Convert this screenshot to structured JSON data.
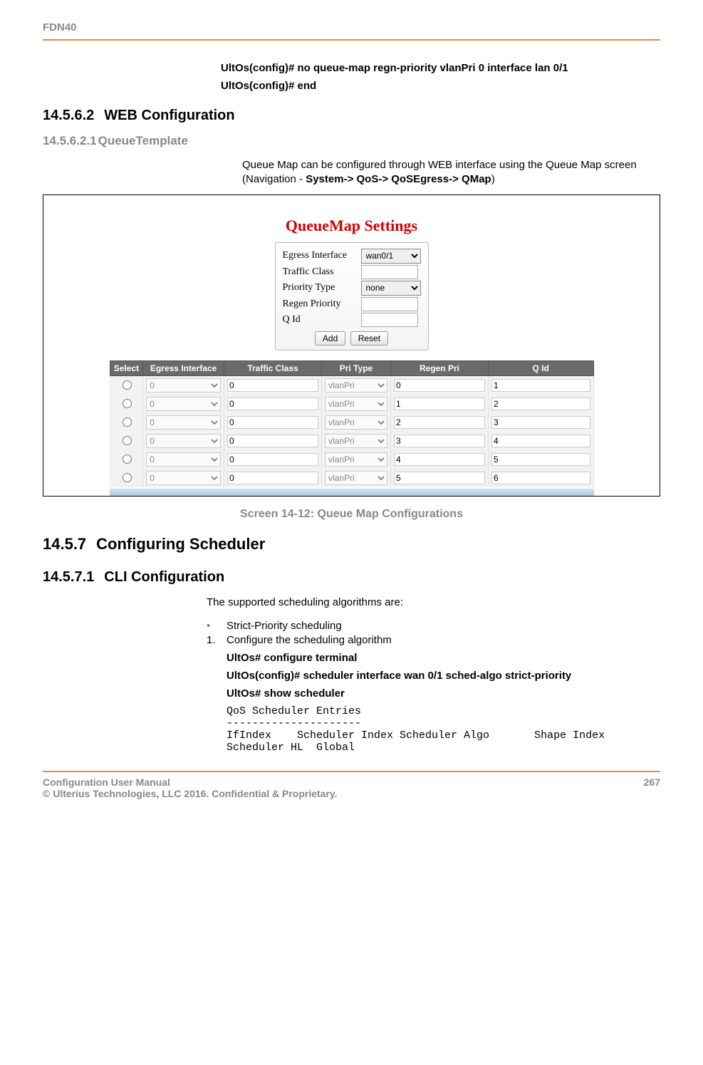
{
  "header": {
    "doc_code": "FDN40"
  },
  "pre_cmds": [
    "UltOs(config)# no queue-map regn-priority vlanPri 0 interface lan 0/1",
    "UltOs(config)# end"
  ],
  "sec_145_6_2": {
    "num": "14.5.6.2",
    "title": "WEB Configuration"
  },
  "sec_145_6_2_1": {
    "num": "14.5.6.2.1",
    "title": "QueueTemplate"
  },
  "qmap_intro_plain1": "Queue Map can be configured through WEB interface using the Queue Map screen (Navigation - ",
  "qmap_intro_bold": "System-> QoS-> QoSEgress-> QMap",
  "qmap_intro_plain2": ")",
  "settings": {
    "title": "QueueMap Settings",
    "form": {
      "rows": [
        {
          "label": "Egress Interface",
          "type": "select",
          "value": "wan0/1"
        },
        {
          "label": "Traffic Class",
          "type": "input",
          "value": ""
        },
        {
          "label": "Priority Type",
          "type": "select",
          "value": "none"
        },
        {
          "label": "Regen Priority",
          "type": "input",
          "value": ""
        },
        {
          "label": "Q Id",
          "type": "input",
          "value": ""
        }
      ],
      "buttons": {
        "add": "Add",
        "reset": "Reset"
      }
    },
    "table": {
      "headers": [
        "Select",
        "Egress Interface",
        "Traffic Class",
        "Pri Type",
        "Regen Pri",
        "Q Id"
      ],
      "rows": [
        {
          "egress": "0",
          "tc": "0",
          "pri": "vlanPri",
          "regen": "0",
          "qid": "1"
        },
        {
          "egress": "0",
          "tc": "0",
          "pri": "vlanPri",
          "regen": "1",
          "qid": "2"
        },
        {
          "egress": "0",
          "tc": "0",
          "pri": "vlanPri",
          "regen": "2",
          "qid": "3"
        },
        {
          "egress": "0",
          "tc": "0",
          "pri": "vlanPri",
          "regen": "3",
          "qid": "4"
        },
        {
          "egress": "0",
          "tc": "0",
          "pri": "vlanPri",
          "regen": "4",
          "qid": "5"
        },
        {
          "egress": "0",
          "tc": "0",
          "pri": "vlanPri",
          "regen": "5",
          "qid": "6"
        }
      ]
    }
  },
  "caption": "Screen 14-12: Queue Map Configurations",
  "sec_145_7": {
    "num": "14.5.7",
    "title": "Configuring Scheduler"
  },
  "sec_145_7_1": {
    "num": "14.5.7.1",
    "title": "CLI Configuration"
  },
  "sched_intro": "The supported scheduling algorithms are:",
  "sched_bullet": "Strict-Priority scheduling",
  "sched_step1": "Configure the scheduling algorithm",
  "sched_cmds": [
    "UltOs# configure terminal",
    "UltOs(config)# scheduler interface wan 0/1 sched-algo strict-priority",
    "UltOs# show scheduler"
  ],
  "sched_output": "QoS Scheduler Entries\n---------------------\nIfIndex    Scheduler Index Scheduler Algo       Shape Index Scheduler HL  Global",
  "footer": {
    "left1": "Configuration User Manual",
    "left2": "© Ulterius Technologies, LLC 2016. Confidential & Proprietary.",
    "page": "267"
  }
}
